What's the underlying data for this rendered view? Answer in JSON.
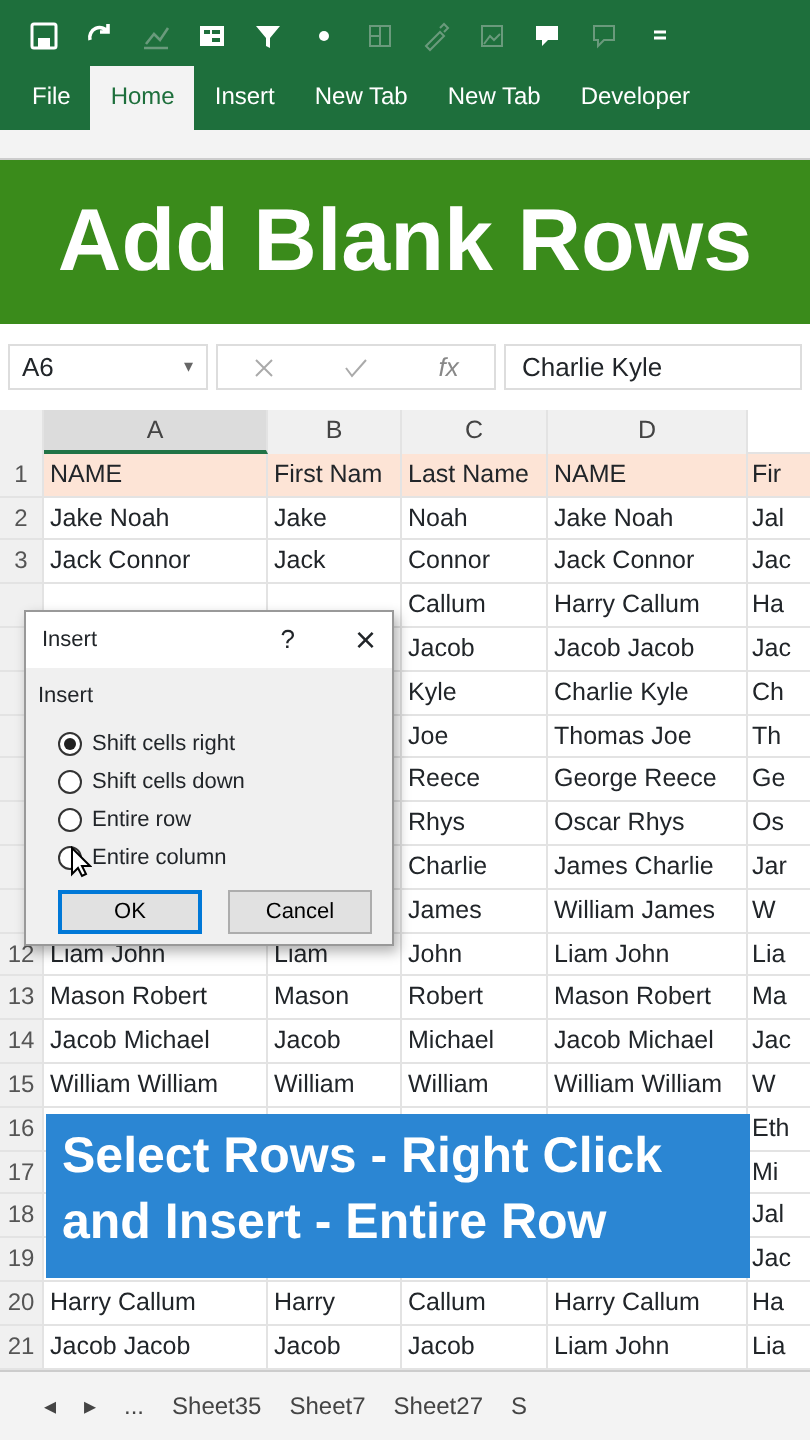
{
  "ribbon_tabs": [
    {
      "label": "File",
      "selected": false
    },
    {
      "label": "Home",
      "selected": true
    },
    {
      "label": "Insert",
      "selected": false
    },
    {
      "label": "New Tab",
      "selected": false
    },
    {
      "label": "New Tab",
      "selected": false
    },
    {
      "label": "Developer",
      "selected": false
    }
  ],
  "title_banner": "Add Blank Rows",
  "formula_bar": {
    "name_box": "A6",
    "caret": "▾",
    "fx": "fx",
    "value": "Charlie Kyle"
  },
  "columns": [
    {
      "label": "A",
      "selected": true
    },
    {
      "label": "B",
      "selected": false
    },
    {
      "label": "C",
      "selected": false
    },
    {
      "label": "D",
      "selected": false
    }
  ],
  "rows": [
    {
      "num": "1",
      "header": true,
      "a": "NAME",
      "b": "First Nam",
      "c": "Last Name",
      "d": "NAME",
      "e": "Fir"
    },
    {
      "num": "2",
      "a": "Jake Noah",
      "b": "Jake",
      "c": "Noah",
      "d": "Jake Noah",
      "e": "Jal"
    },
    {
      "num": "3",
      "a": "Jack Connor",
      "b": "Jack",
      "c": "Connor",
      "d": "Jack Connor",
      "e": "Jac"
    },
    {
      "c": "Callum",
      "d": "Harry Callum",
      "e": "Ha"
    },
    {
      "c": "Jacob",
      "d": "Jacob  Jacob",
      "e": "Jac"
    },
    {
      "c": "Kyle",
      "d": "Charlie Kyle",
      "e": "Ch"
    },
    {
      "c": "Joe",
      "d": "Thomas Joe",
      "e": "Th"
    },
    {
      "c": "Reece",
      "d": "George Reece",
      "e": "Ge"
    },
    {
      "c": "Rhys",
      "d": "Oscar Rhys",
      "e": "Os"
    },
    {
      "c": "Charlie",
      "d": "James Charlie",
      "e": "Jar"
    },
    {
      "c": "James",
      "d": "William James",
      "e": "W"
    },
    {
      "num": "12",
      "a": "Liam John",
      "b": "Liam",
      "c": "John",
      "d": "Liam John",
      "e": "Lia"
    },
    {
      "num": "13",
      "a": "Mason Robert",
      "b": "Mason",
      "c": "Robert",
      "d": "Mason Robert",
      "e": "Ma"
    },
    {
      "num": "14",
      "a": "Jacob Michael",
      "b": "Jacob",
      "c": "Michael",
      "d": "Jacob Michael",
      "e": "Jac"
    },
    {
      "num": "15",
      "a": "William William",
      "b": "William",
      "c": "William",
      "d": "William William",
      "e": "W"
    },
    {
      "num": "16",
      "e": "Eth"
    },
    {
      "num": "17",
      "e": "Mi"
    },
    {
      "num": "18",
      "e": "Jal"
    },
    {
      "num": "19",
      "e": "Jac"
    },
    {
      "num": "20",
      "a": "Harry Callum",
      "b": "Harry",
      "c": "Callum",
      "d": "Harry Callum",
      "e": "Ha"
    },
    {
      "num": "21",
      "a": "Jacob  Jacob",
      "b": "Jacob",
      "c": "Jacob",
      "d": "Liam John",
      "e": "Lia"
    }
  ],
  "dialog": {
    "title": "Insert",
    "help": "?",
    "close": "×",
    "group": "Insert",
    "options": [
      {
        "label": "Shift cells right",
        "selected": true
      },
      {
        "label": "Shift cells down",
        "selected": false
      },
      {
        "label": "Entire row",
        "selected": false
      },
      {
        "label": "Entire column",
        "selected": false
      }
    ],
    "ok": "OK",
    "cancel": "Cancel"
  },
  "caption_banner": [
    "Select Rows - Right Click",
    "and Insert - Entire Row"
  ],
  "sheet_nav": [
    "◂",
    "▸",
    "..."
  ],
  "sheet_tabs": [
    "Sheet35",
    "Sheet7",
    "Sheet27",
    "S"
  ]
}
